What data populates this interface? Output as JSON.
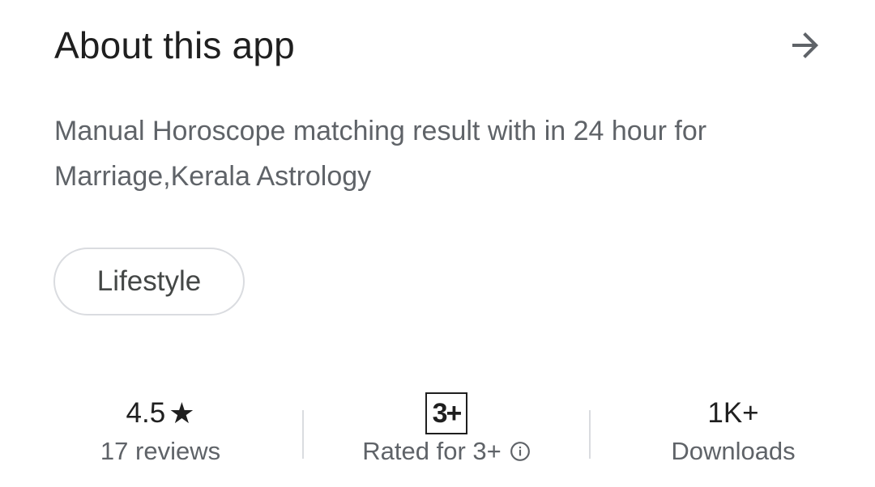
{
  "header": {
    "title": "About this app",
    "arrow_icon": "arrow-right-icon"
  },
  "description": "Manual Horoscope matching result with in 24 hour for Marriage,Kerala Astrology",
  "category_chip": "Lifestyle",
  "stats": {
    "rating": {
      "value": "4.5",
      "star_icon": "star-icon",
      "label": "17 reviews"
    },
    "content_rating": {
      "badge": "3+",
      "label": "Rated for 3+",
      "info_icon": "info-icon"
    },
    "downloads": {
      "value": "1K+",
      "label": "Downloads"
    }
  },
  "colors": {
    "primary_text": "#1f1f1f",
    "secondary_text": "#5f6368",
    "chip_border": "#dadce0",
    "divider": "#dadce0"
  }
}
